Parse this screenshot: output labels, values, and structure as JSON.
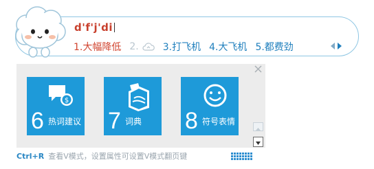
{
  "composition": {
    "pinyin": "d'f'j'di"
  },
  "candidates": [
    {
      "index": "1.",
      "text": "大幅降低",
      "state": "selected"
    },
    {
      "index": "2.",
      "text": "",
      "state": "cloud-loading",
      "icon": "cloud-icon"
    },
    {
      "index": "3.",
      "text": "打飞机",
      "state": "normal"
    },
    {
      "index": "4.",
      "text": "大飞机",
      "state": "normal"
    },
    {
      "index": "5.",
      "text": "都费劲",
      "state": "normal"
    }
  ],
  "tiles": [
    {
      "number": "6",
      "label": "热词建议",
      "icon": "chat-bubble-search-icon"
    },
    {
      "number": "7",
      "label": "词典",
      "icon": "dictionary-book-icon"
    },
    {
      "number": "8",
      "label": "符号表情",
      "icon": "smiley-icon"
    }
  ],
  "footer": {
    "shortcut": "Ctrl+R",
    "hint": "查看V模式，设置属性可设置V模式翻页键"
  },
  "colors": {
    "accent": "#1e9ad9",
    "selected_candidate": "#d1442f",
    "candidate": "#1f7fbd",
    "pinyin": "#c8402d",
    "border": "#8ec6e3"
  }
}
